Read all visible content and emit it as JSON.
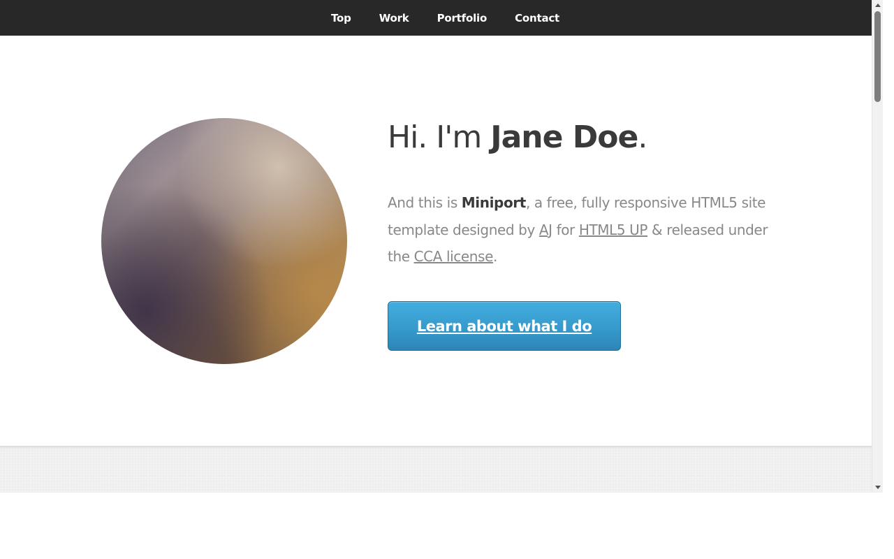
{
  "nav": {
    "items": [
      {
        "label": "Top"
      },
      {
        "label": "Work"
      },
      {
        "label": "Portfolio"
      },
      {
        "label": "Contact"
      }
    ]
  },
  "hero": {
    "greeting_prefix": "Hi. I'm ",
    "name": "Jane Doe",
    "greeting_suffix": ".",
    "intro": {
      "part1": "And this is ",
      "site_name": "Miniport",
      "part2": ", a free, fully responsive HTML5 site template designed by ",
      "author_link": "AJ",
      "part3": " for ",
      "publisher_link": "HTML5 UP",
      "part4": " & released under the ",
      "license_link": "CCA license",
      "part5": "."
    },
    "cta_label": "Learn about what I do"
  },
  "colors": {
    "nav_bg": "#282828",
    "button_blue": "#3598c9",
    "heading_text": "#3a3a3a",
    "body_text": "#888888"
  },
  "icons": {
    "scroll_up": "chevron-up-icon",
    "scroll_down": "chevron-down-icon"
  }
}
